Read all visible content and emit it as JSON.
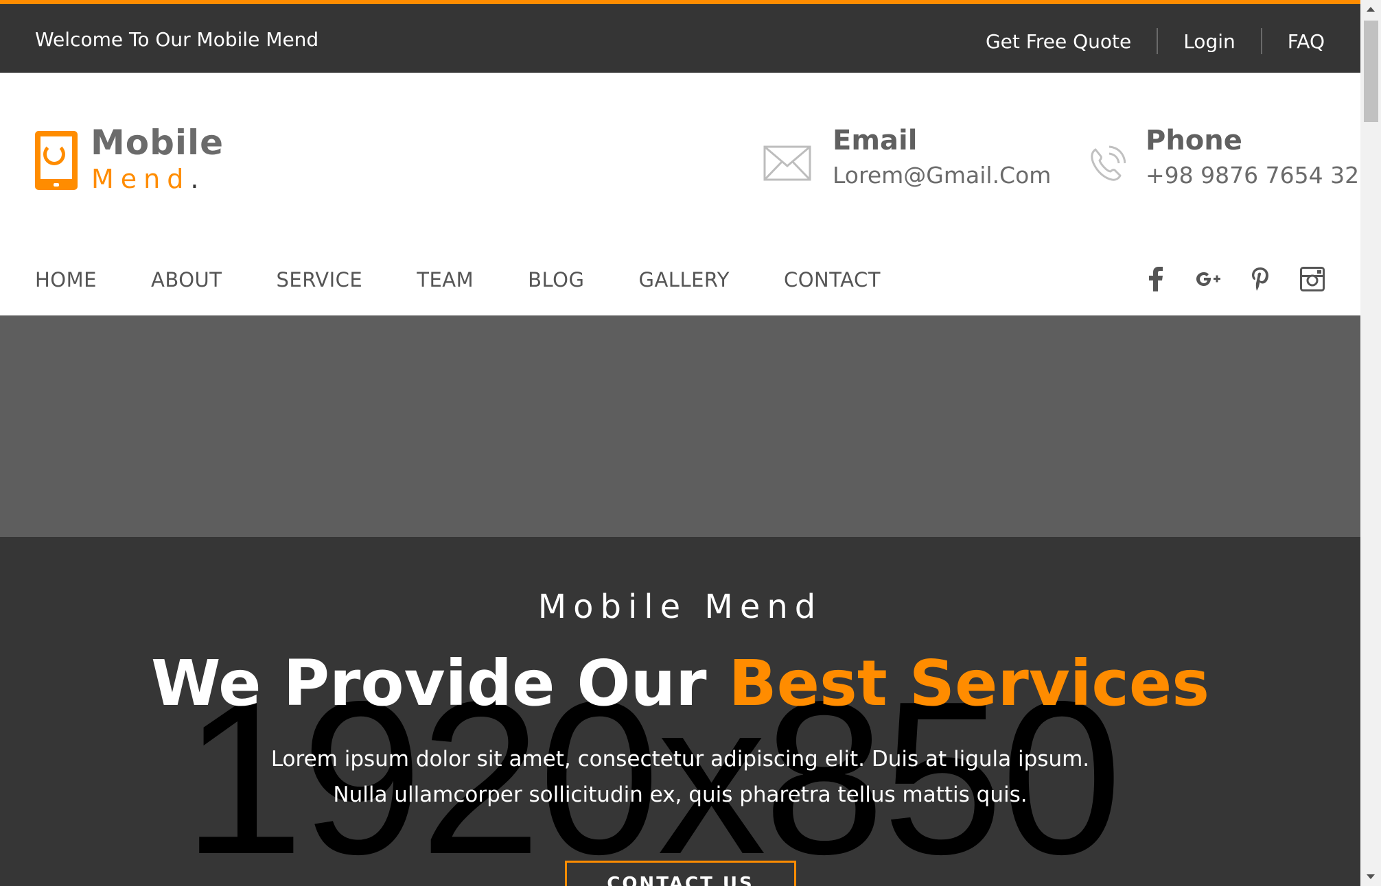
{
  "topbar": {
    "welcome": "Welcome To Our Mobile Mend",
    "links": [
      "Get Free Quote",
      "Login",
      "FAQ"
    ]
  },
  "logo": {
    "word1": "Mobile",
    "word2": "Mend",
    "period": "."
  },
  "contact": {
    "email_title": "Email",
    "email_value": "Lorem@Gmail.Com",
    "phone_title": "Phone",
    "phone_value": "+98 9876 7654 32"
  },
  "nav": {
    "items": [
      "HOME",
      "ABOUT",
      "SERVICE",
      "TEAM",
      "BLOG",
      "GALLERY",
      "CONTACT"
    ],
    "socials": [
      "facebook-icon",
      "google-plus-icon",
      "pinterest-icon",
      "instagram-icon"
    ]
  },
  "hero": {
    "placeholder": "1920x850",
    "kicker": "Mobile Mend",
    "title_main": "We Provide Our ",
    "title_accent": "Best Services",
    "sub_line1": "Lorem ipsum dolor sit amet, consectetur adipiscing elit. Duis at ligula ipsum.",
    "sub_line2": "Nulla ullamcorper sollicitudin ex, quis pharetra tellus mattis quis.",
    "button": "CONTACT US"
  },
  "colors": {
    "accent": "#ff8c00",
    "dark": "#353535",
    "hero_top": "#5e5e5e"
  }
}
